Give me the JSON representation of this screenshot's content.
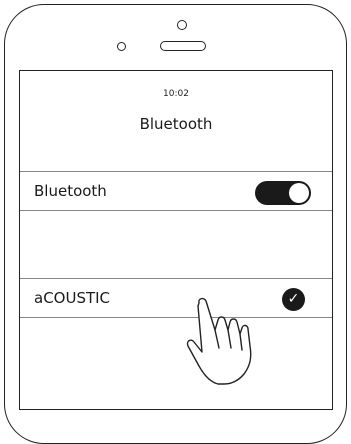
{
  "status_bar": {
    "time": "10:02"
  },
  "screen": {
    "title": "Bluetooth"
  },
  "bluetooth_row": {
    "label": "Bluetooth",
    "toggle_on": true
  },
  "device_row": {
    "label": "aCOUSTIC",
    "connected": true,
    "check_glyph": "✓"
  },
  "colors": {
    "ink": "#1a1a1a",
    "background": "#ffffff",
    "divider": "#888888"
  },
  "icons": {
    "toggle": "toggle-switch-icon",
    "check": "check-circle-icon",
    "hand": "pointing-hand-icon"
  }
}
